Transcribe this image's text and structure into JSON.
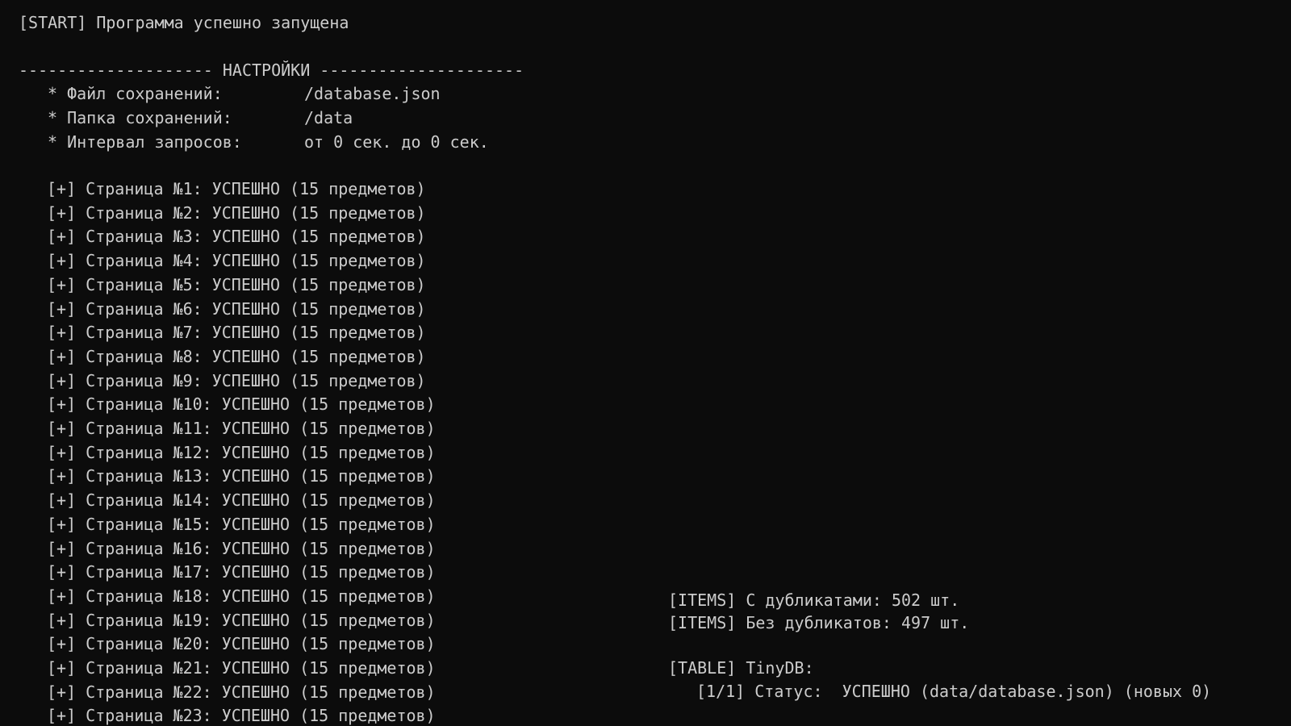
{
  "start_line": "[START] Программа успешно запущена",
  "settings": {
    "header": "-------------------- НАСТРОЙКИ ---------------------",
    "items": [
      {
        "label": "* Файл сохранений:",
        "value": "/database.json"
      },
      {
        "label": "* Папка сохранений:",
        "value": "/data"
      },
      {
        "label": "* Интервал запросов:",
        "value": "от 0 сек. до 0 сек."
      }
    ]
  },
  "pages": [
    "[+] Страница №1: УСПЕШНО (15 предметов)",
    "[+] Страница №2: УСПЕШНО (15 предметов)",
    "[+] Страница №3: УСПЕШНО (15 предметов)",
    "[+] Страница №4: УСПЕШНО (15 предметов)",
    "[+] Страница №5: УСПЕШНО (15 предметов)",
    "[+] Страница №6: УСПЕШНО (15 предметов)",
    "[+] Страница №7: УСПЕШНО (15 предметов)",
    "[+] Страница №8: УСПЕШНО (15 предметов)",
    "[+] Страница №9: УСПЕШНО (15 предметов)",
    "[+] Страница №10: УСПЕШНО (15 предметов)",
    "[+] Страница №11: УСПЕШНО (15 предметов)",
    "[+] Страница №12: УСПЕШНО (15 предметов)",
    "[+] Страница №13: УСПЕШНО (15 предметов)",
    "[+] Страница №14: УСПЕШНО (15 предметов)",
    "[+] Страница №15: УСПЕШНО (15 предметов)",
    "[+] Страница №16: УСПЕШНО (15 предметов)",
    "[+] Страница №17: УСПЕШНО (15 предметов)",
    "[+] Страница №18: УСПЕШНО (15 предметов)",
    "[+] Страница №19: УСПЕШНО (15 предметов)",
    "[+] Страница №20: УСПЕШНО (15 предметов)",
    "[+] Страница №21: УСПЕШНО (15 предметов)",
    "[+] Страница №22: УСПЕШНО (15 предметов)",
    "[+] Страница №23: УСПЕШНО (15 предметов)"
  ],
  "items_summary": [
    "[ITEMS] С дубликатами: 502 шт.",
    "[ITEMS] Без дубликатов: 497 шт."
  ],
  "table": {
    "header": "[TABLE] TinyDB:",
    "status": "[1/1] Статус:  УСПЕШНО (data/database.json) (новых 0)"
  },
  "colors": {
    "background": "#0c0c0c",
    "text": "#cccccc"
  }
}
